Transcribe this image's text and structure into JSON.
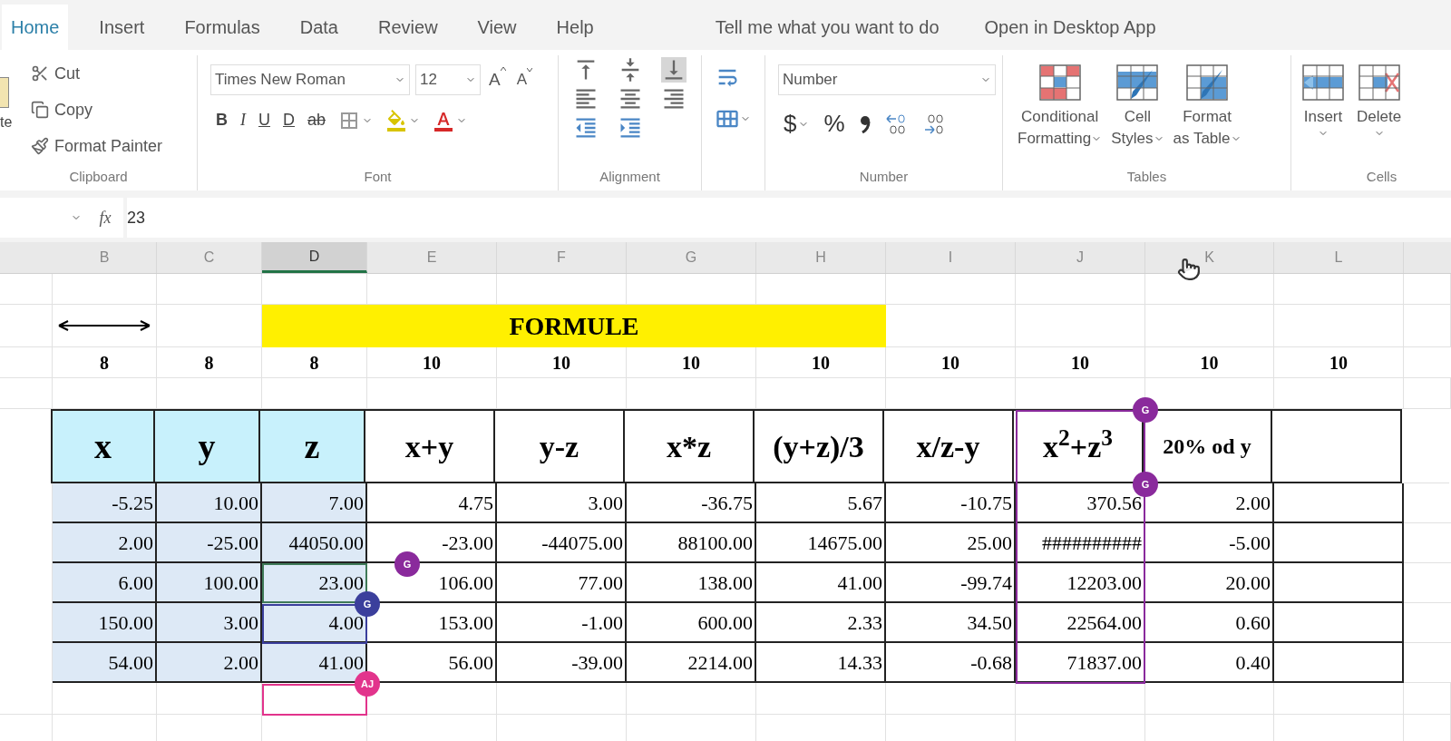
{
  "tabs": [
    {
      "label": "Home",
      "selected": true
    },
    {
      "label": "Insert",
      "selected": false
    },
    {
      "label": "Formulas",
      "selected": false
    },
    {
      "label": "Data",
      "selected": false
    },
    {
      "label": "Review",
      "selected": false
    },
    {
      "label": "View",
      "selected": false
    },
    {
      "label": "Help",
      "selected": false
    }
  ],
  "tell_me": "Tell me what you want to do",
  "open_desktop": "Open in Desktop App",
  "ribbon": {
    "paste_label": "te",
    "clipboard": {
      "items": [
        "Cut",
        "Copy",
        "Format Painter"
      ],
      "label": "Clipboard"
    },
    "font": {
      "name": "Times New Roman",
      "size": "12",
      "style_buttons": [
        "B",
        "I",
        "U",
        "D",
        "ab"
      ],
      "grow": "A",
      "shrink": "A",
      "label": "Font"
    },
    "alignment": {
      "label": "Alignment"
    },
    "number": {
      "format": "Number",
      "currency": "$",
      "percent": "%",
      "label": "Number"
    },
    "tables": {
      "buttons": [
        {
          "line1": "Conditional",
          "line2": "Formatting"
        },
        {
          "line1": "Cell",
          "line2": "Styles"
        },
        {
          "line1": "Format",
          "line2": "as Table"
        }
      ],
      "label": "Tables"
    },
    "cells": {
      "buttons": [
        "Insert",
        "Delete"
      ],
      "label": "Cells"
    }
  },
  "formula_bar": {
    "function_label": "fx",
    "value": "23"
  },
  "columns": [
    {
      "label": "B",
      "selected": false
    },
    {
      "label": "C",
      "selected": false
    },
    {
      "label": "D",
      "selected": true
    },
    {
      "label": "E",
      "selected": false
    },
    {
      "label": "F",
      "selected": false
    },
    {
      "label": "G",
      "selected": false
    },
    {
      "label": "H",
      "selected": false
    },
    {
      "label": "I",
      "selected": false
    },
    {
      "label": "J",
      "selected": false
    },
    {
      "label": "K",
      "selected": false
    },
    {
      "label": "L",
      "selected": false
    }
  ],
  "title": "FORMULE",
  "widths": [
    "8",
    "8",
    "8",
    "10",
    "10",
    "10",
    "10",
    "10",
    "10",
    "10",
    "10"
  ],
  "headers": [
    {
      "text": "x",
      "kind": "input"
    },
    {
      "text": "y",
      "kind": "input"
    },
    {
      "text": "z",
      "kind": "input"
    },
    {
      "text": "x+y",
      "kind": "formula"
    },
    {
      "text": "y-z",
      "kind": "formula"
    },
    {
      "text": "x*z",
      "kind": "formula"
    },
    {
      "text": "(y+z)/3",
      "kind": "formula"
    },
    {
      "text": "x/z-y",
      "kind": "formula"
    },
    {
      "text": "x$^{2}$+z$^{3}$",
      "kind": "formula"
    },
    {
      "text": "20% od y",
      "kind": "small"
    }
  ],
  "rows": [
    {
      "active": false,
      "values": [
        "-5.25",
        "10.00",
        "7.00",
        "4.75",
        "3.00",
        "-36.75",
        "5.67",
        "-10.75",
        "370.56",
        "2.00"
      ]
    },
    {
      "active": false,
      "values": [
        "2.00",
        "-25.00",
        "44050.00",
        "-23.00",
        "-44075.00",
        "88100.00",
        "14675.00",
        "25.00",
        "##########",
        "-5.00"
      ]
    },
    {
      "active": true,
      "values": [
        "6.00",
        "100.00",
        "23.00",
        "106.00",
        "77.00",
        "138.00",
        "41.00",
        "-99.74",
        "12203.00",
        "20.00"
      ]
    },
    {
      "active": false,
      "values": [
        "150.00",
        "3.00",
        "4.00",
        "153.00",
        "-1.00",
        "600.00",
        "2.33",
        "34.50",
        "22564.00",
        "0.60"
      ]
    },
    {
      "active": false,
      "values": [
        "54.00",
        "2.00",
        "41.00",
        "56.00",
        "-39.00",
        "2214.00",
        "14.33",
        "-0.68",
        "71837.00",
        "0.40"
      ]
    }
  ],
  "collaborators": [
    {
      "initials": "G",
      "color": "#8a2a9c"
    },
    {
      "initials": "G",
      "color": "#3b3f9c"
    },
    {
      "initials": "AJ",
      "color": "#e2348c"
    },
    {
      "initials": "G",
      "color": "#8a2a9c"
    },
    {
      "initials": "G",
      "color": "#8a2a9c"
    }
  ]
}
